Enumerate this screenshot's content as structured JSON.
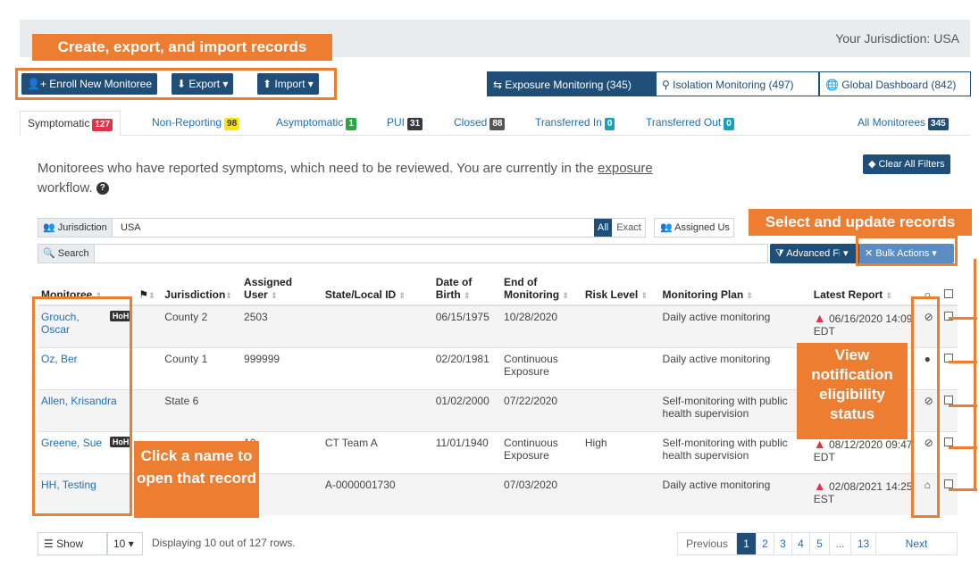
{
  "header": {
    "jurisdiction_title": "Your Jurisdiction: USA"
  },
  "toolbar": {
    "enroll": "Enroll New Monitoree",
    "export": "Export",
    "import": "Import"
  },
  "workflow_tabs": [
    {
      "label": "Exposure Monitoring (345)"
    },
    {
      "label": "Isolation Monitoring (497)"
    },
    {
      "label": "Global Dashboard (842)"
    }
  ],
  "line_tabs": [
    {
      "label": "Symptomatic",
      "count": "127"
    },
    {
      "label": "Non-Reporting",
      "count": "98"
    },
    {
      "label": "Asymptomatic",
      "count": "1"
    },
    {
      "label": "PUI",
      "count": "31"
    },
    {
      "label": "Closed",
      "count": "88"
    },
    {
      "label": "Transferred In",
      "count": "0"
    },
    {
      "label": "Transferred Out",
      "count": "0"
    },
    {
      "label": "All Monitorees",
      "count": "345"
    }
  ],
  "description": {
    "pre": "Monitorees who have reported symptoms, which need to be reviewed. You are currently in the ",
    "link": "exposure",
    "post": " workflow."
  },
  "clear_filters": "Clear All Filters",
  "filters": {
    "jurisdiction_label": "Jurisdiction",
    "jurisdiction_value": "USA",
    "all": "All",
    "exact": "Exact",
    "assigned_user": "Assigned Us",
    "search_label": "Search",
    "advanced_filter": "Advanced Filter",
    "bulk_actions": "Bulk Actions"
  },
  "table": {
    "headers": [
      "Monitoree",
      "Jurisdiction",
      "Assigned User",
      "State/Local ID",
      "Date of Birth",
      "End of Monitoring",
      "Risk Level",
      "Monitoring Plan",
      "Latest Report"
    ],
    "rows": [
      {
        "name": "Grouch, Oscar",
        "hoh": "HoH",
        "jurisdiction": "County 2",
        "user": "2503",
        "local_id": "",
        "dob": "06/15/1975",
        "end": "10/28/2020",
        "risk": "",
        "plan": "Daily active monitoring",
        "report": "06/16/2020 14:09 EDT"
      },
      {
        "name": "Oz, Ber",
        "hoh": "",
        "jurisdiction": "County 1",
        "user": "999999",
        "local_id": "",
        "dob": "02/20/1981",
        "end": "Continuous Exposure",
        "risk": "",
        "plan": "Daily active monitoring",
        "report": ""
      },
      {
        "name": "Allen, Krisandra",
        "hoh": "",
        "jurisdiction": "State 6",
        "user": "",
        "local_id": "",
        "dob": "01/02/2000",
        "end": "07/22/2020",
        "risk": "",
        "plan": "Self-monitoring with public health supervision",
        "report": ""
      },
      {
        "name": "Greene, Sue",
        "hoh": "HoH",
        "jurisdiction": "",
        "user": "10",
        "local_id": "CT Team A",
        "dob": "11/01/1940",
        "end": "Continuous Exposure",
        "risk": "High",
        "plan": "Self-monitoring with public health supervision",
        "report": "08/12/2020 09:47 EDT"
      },
      {
        "name": "HH, Testing",
        "hoh": "",
        "jurisdiction": "",
        "user": "",
        "local_id": "A-0000001730",
        "dob": "",
        "end": "07/03/2020",
        "risk": "",
        "plan": "Daily active monitoring",
        "report": "02/08/2021 14:25 EST"
      }
    ]
  },
  "footer": {
    "show": "Show",
    "per_page": "10",
    "displaying": "Displaying 10 out of 127 rows.",
    "previous": "Previous",
    "pages": [
      "1",
      "2",
      "3",
      "4",
      "5",
      "...",
      "13"
    ],
    "next": "Next"
  },
  "annotations": {
    "create": "Create, export, and import records",
    "select": "Select and update records",
    "view": "View notification eligibility status",
    "click": "Click a name to open that record"
  },
  "colors": {
    "accent": "#ed7d31",
    "primary": "#1f4e79",
    "link": "#1f6fb5",
    "danger": "#dc3545"
  }
}
